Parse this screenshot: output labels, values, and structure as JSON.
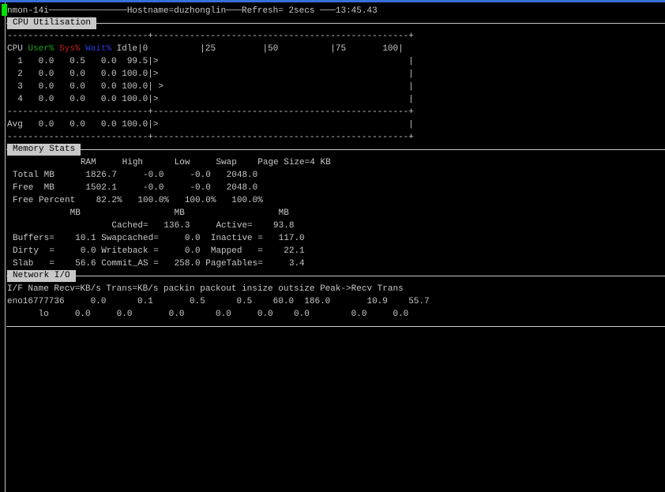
{
  "header": {
    "program": "nmon-14i",
    "hostname": "Hostname=duzhonglin",
    "refresh": "Refresh= 2secs",
    "time": "13:45.43",
    "full": "nmon-14i───────────────Hostname=duzhonglin───Refresh= 2secs ───13:45.43"
  },
  "cpu": {
    "section_title": "CPU Utilisation",
    "rule": "---------------------------+-------------------------------------------------+",
    "header_cpu": "CPU ",
    "header_user": "User%",
    "header_sys": "Sys%",
    "header_wait": "Wait%",
    "header_idle": " Idle|0          |25         |50          |75       100|",
    "rows": [
      "  1   0.0   0.5   0.0  99.5|>                                                |",
      "  2   0.0   0.0   0.0 100.0|>                                                |",
      "  3   0.0   0.0   0.0 100.0| >                                               |",
      "  4   0.0   0.0   0.0 100.0|>                                                |"
    ],
    "avg": "Avg   0.0   0.0   0.0 100.0|>                                                |"
  },
  "memory": {
    "section_title": "Memory Stats",
    "lines": [
      "             RAM     High      Low     Swap    Page Size=4 KB",
      "Total MB      1826.7     -0.0     -0.0   2048.0",
      "Free  MB      1502.1     -0.0     -0.0   2048.0",
      "Free Percent    82.2%   100.0%   100.0%   100.0%",
      "           MB                  MB                  MB",
      "                   Cached=   136.3     Active=    93.8",
      "Buffers=    10.1 Swapcached=     0.0  Inactive =   117.0",
      "Dirty  =     0.0 Writeback =     0.0  Mapped   =    22.1",
      "Slab   =    56.6 Commit_AS =   258.0 PageTables=     3.4"
    ]
  },
  "network": {
    "section_title": "Network I/O",
    "header": "I/F Name Recv=KB/s Trans=KB/s packin packout insize outsize Peak->Recv Trans",
    "rows": [
      "eno16777736     0.0      0.1       0.5      0.5    60.0  186.0       10.9    55.7",
      "      lo     0.0     0.0       0.0      0.0     0.0    0.0        0.0     0.0"
    ]
  },
  "colors": {
    "background": "#000000",
    "text": "#c8c8c8",
    "user": "#1fa31f",
    "sys": "#c02020",
    "wait": "#2a3ad8",
    "cursor": "#00e000",
    "titlebar": "#3a6fd8"
  }
}
